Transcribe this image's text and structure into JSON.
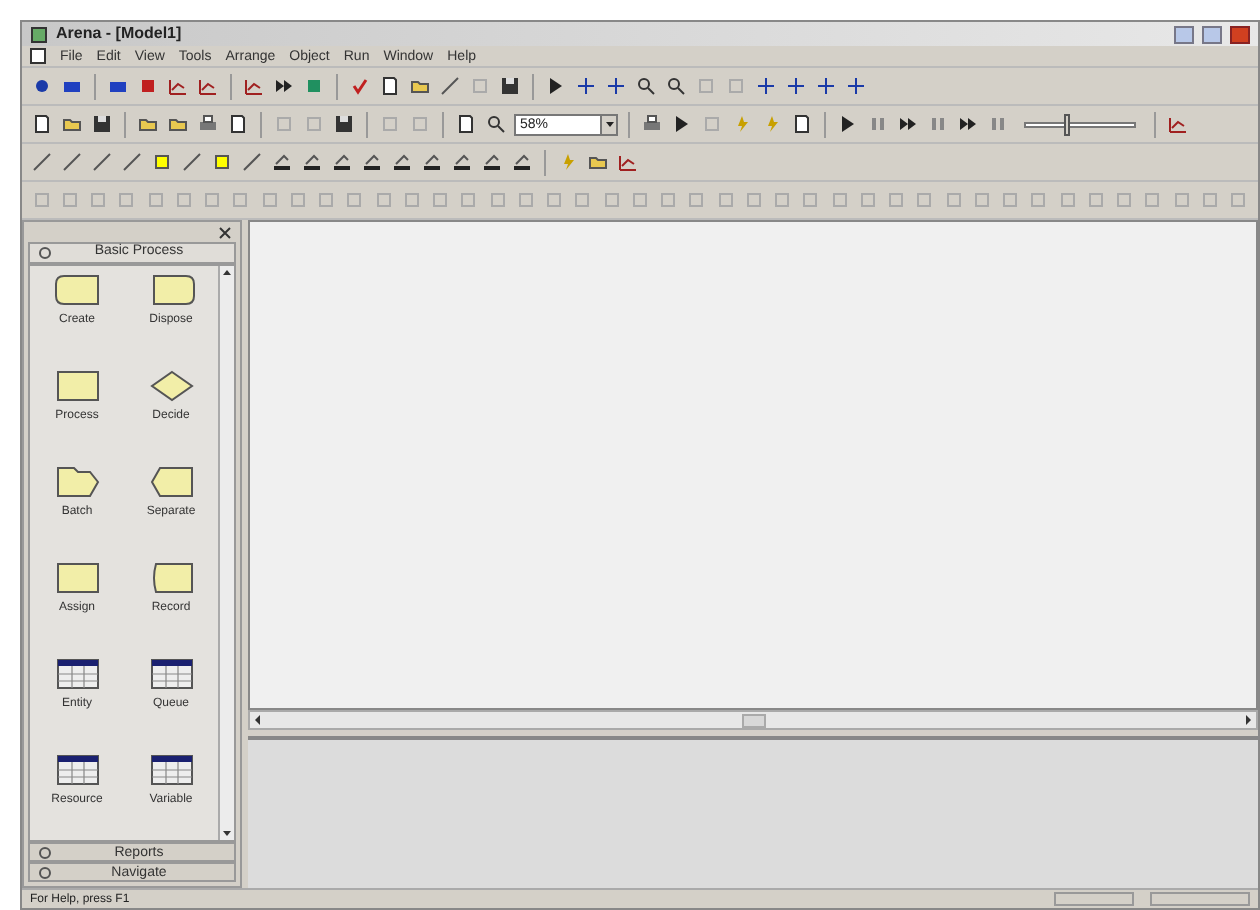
{
  "window": {
    "title": "Arena - [Model1]"
  },
  "menu": [
    "File",
    "Edit",
    "View",
    "Tools",
    "Arrange",
    "Object",
    "Run",
    "Window",
    "Help"
  ],
  "toolbar": {
    "zoom": "58%",
    "speed_slider": {
      "level": 0.35
    }
  },
  "project_bar": {
    "panel_title": "Basic Process",
    "modules": [
      {
        "label": "Create",
        "kind": "create"
      },
      {
        "label": "Dispose",
        "kind": "dispose"
      },
      {
        "label": "Process",
        "kind": "process"
      },
      {
        "label": "Decide",
        "kind": "decide"
      },
      {
        "label": "Batch",
        "kind": "batch"
      },
      {
        "label": "Separate",
        "kind": "separate"
      },
      {
        "label": "Assign",
        "kind": "process"
      },
      {
        "label": "Record",
        "kind": "record"
      },
      {
        "label": "Entity",
        "kind": "table"
      },
      {
        "label": "Queue",
        "kind": "table"
      },
      {
        "label": "Resource",
        "kind": "table"
      },
      {
        "label": "Variable",
        "kind": "table"
      }
    ],
    "other_panels": [
      "Reports",
      "Navigate"
    ]
  },
  "status_bar": {
    "message": "For Help, press F1"
  }
}
